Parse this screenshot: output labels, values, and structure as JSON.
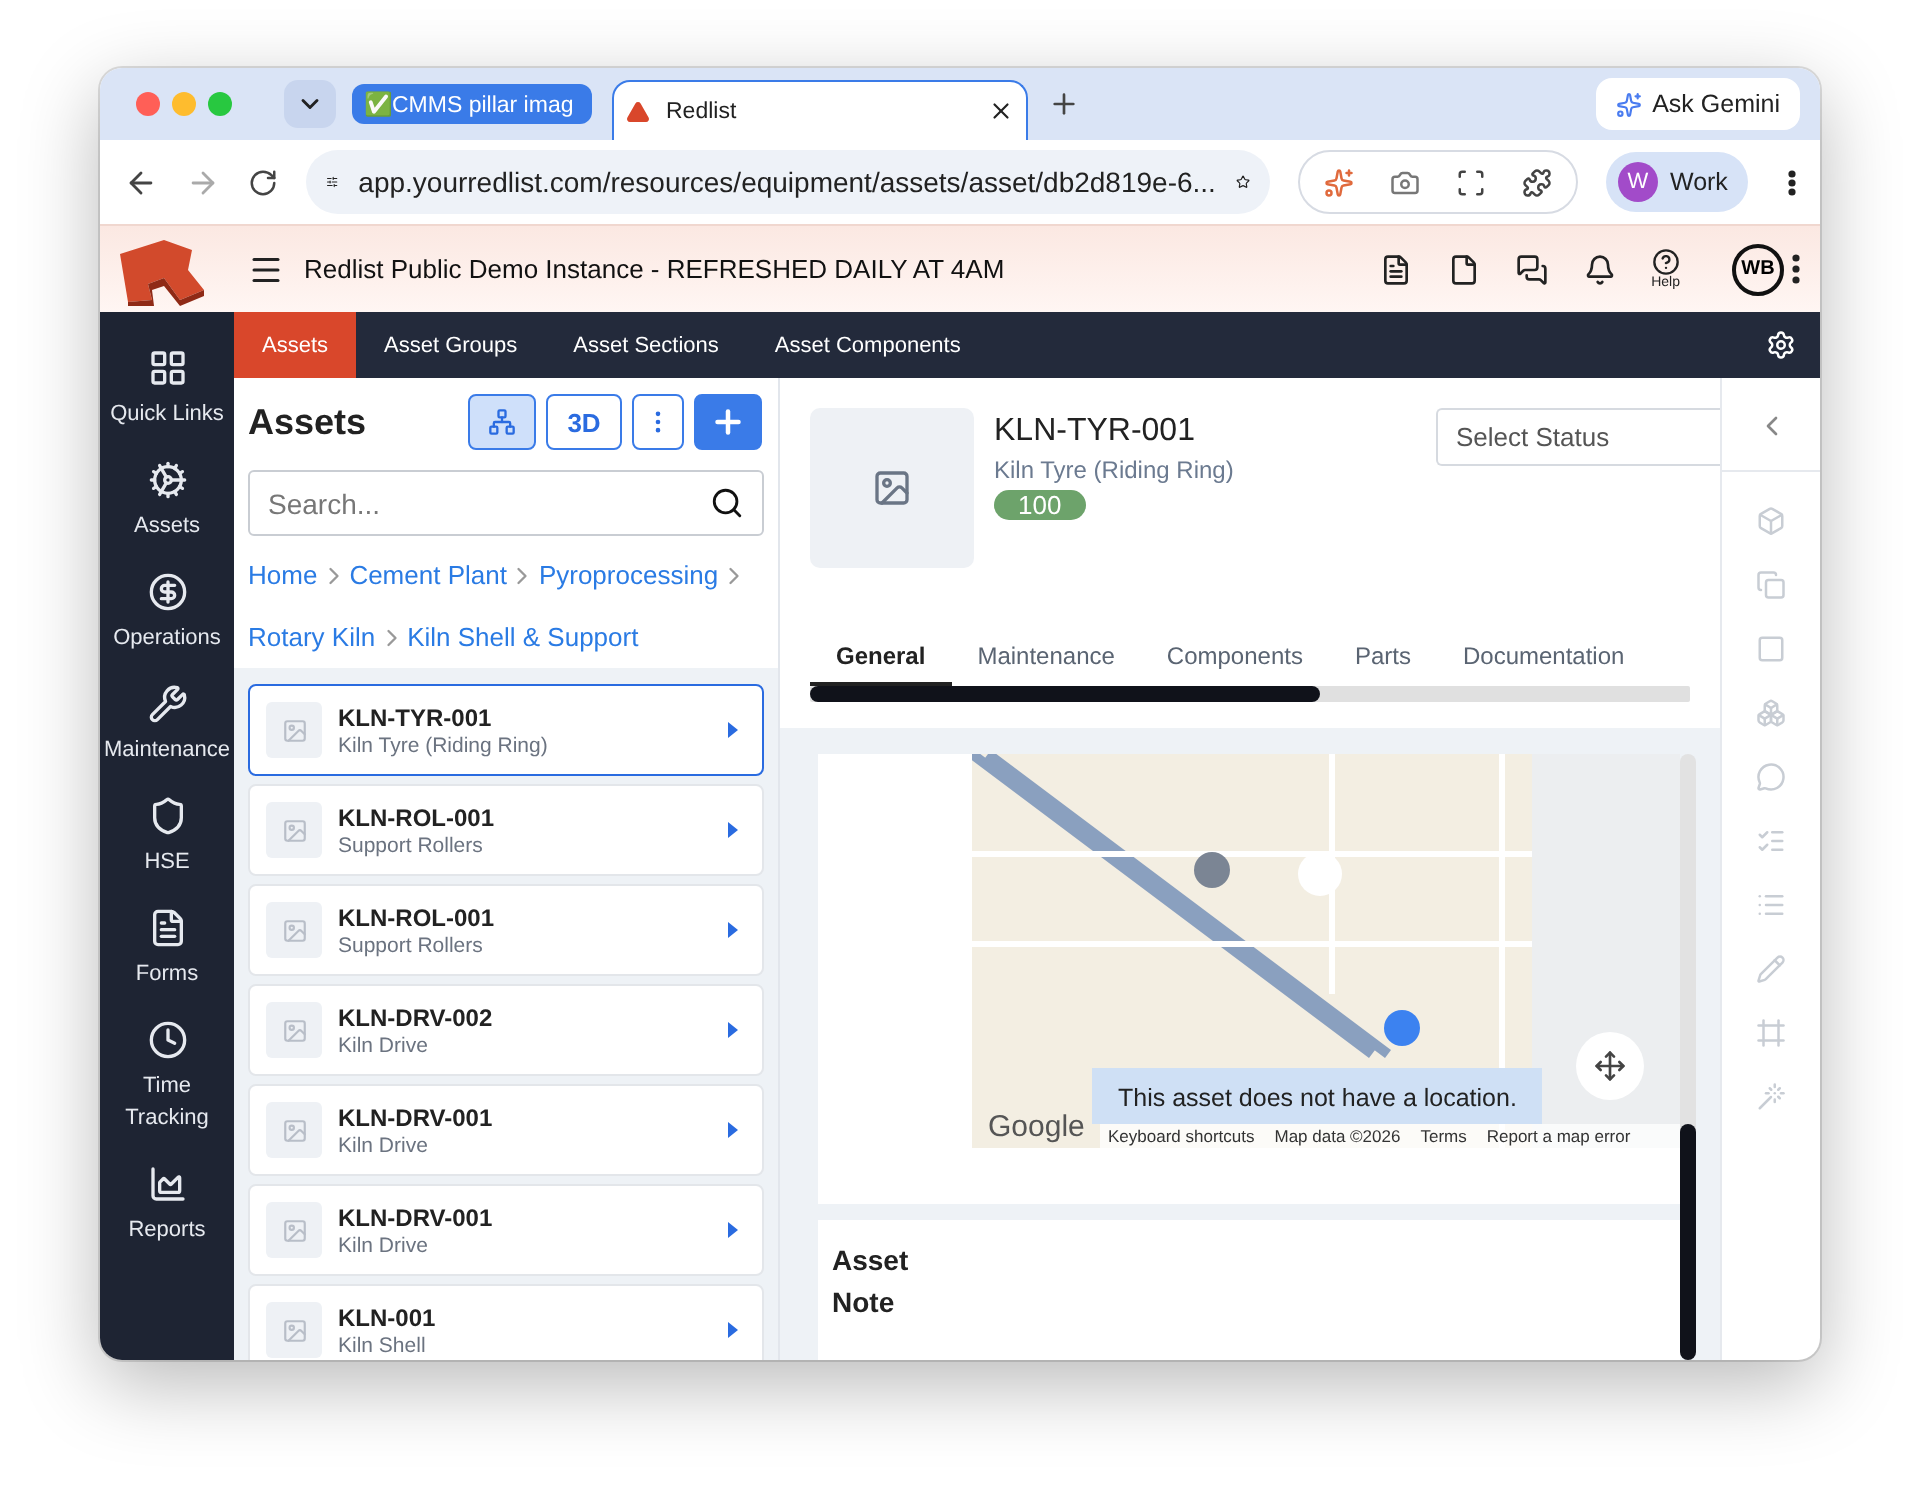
{
  "browser": {
    "tabs": [
      {
        "title": "✅CMMS pillar imag",
        "selected": false
      },
      {
        "title": "Redlist",
        "selected": true
      }
    ],
    "ask_button": "Ask Gemini",
    "url": "app.yourredlist.com/resources/equipment/assets/asset/db2d819e-6...",
    "profile": {
      "initial": "W",
      "label": "Work"
    }
  },
  "app_header": {
    "title": "Redlist Public Demo Instance - REFRESHED DAILY AT 4AM",
    "help_label": "Help",
    "avatar": "WB"
  },
  "sidebar": {
    "items": [
      "Quick Links",
      "Assets",
      "Operations",
      "Maintenance",
      "HSE",
      "Forms",
      "Time Tracking",
      "Reports"
    ]
  },
  "nav_tabs": [
    {
      "label": "Assets",
      "selected": true
    },
    {
      "label": "Asset Groups",
      "selected": false
    },
    {
      "label": "Asset Sections",
      "selected": false
    },
    {
      "label": "Asset Components",
      "selected": false
    }
  ],
  "assets_panel": {
    "title": "Assets",
    "view_button": "3D",
    "search": {
      "placeholder": "Search..."
    },
    "breadcrumb": [
      "Home",
      "Cement Plant",
      "Pyroprocessing",
      "Rotary Kiln",
      "Kiln Shell & Support"
    ],
    "items": [
      {
        "code": "KLN-TYR-001",
        "name": "Kiln Tyre (Riding Ring)",
        "selected": true
      },
      {
        "code": "KLN-ROL-001",
        "name": "Support Rollers",
        "selected": false
      },
      {
        "code": "KLN-ROL-001",
        "name": "Support Rollers",
        "selected": false
      },
      {
        "code": "KLN-DRV-002",
        "name": "Kiln Drive",
        "selected": false
      },
      {
        "code": "KLN-DRV-001",
        "name": "Kiln Drive",
        "selected": false
      },
      {
        "code": "KLN-DRV-001",
        "name": "Kiln Drive",
        "selected": false
      },
      {
        "code": "KLN-001",
        "name": "Kiln Shell",
        "selected": false
      }
    ]
  },
  "detail": {
    "code": "KLN-TYR-001",
    "name": "Kiln Tyre (Riding Ring)",
    "score": "100",
    "status": {
      "placeholder": "Select Status"
    },
    "tabs": [
      {
        "label": "General",
        "selected": true
      },
      {
        "label": "Maintenance",
        "selected": false
      },
      {
        "label": "Components",
        "selected": false
      },
      {
        "label": "Parts",
        "selected": false
      },
      {
        "label": "Documentation",
        "selected": false
      }
    ],
    "map": {
      "message": "This asset does not have a location.",
      "logo": "Google",
      "attribution": [
        "Keyboard shortcuts",
        "Map data ©2026",
        "Terms",
        "Report a map error"
      ]
    },
    "note": {
      "title": "Asset Note"
    }
  }
}
